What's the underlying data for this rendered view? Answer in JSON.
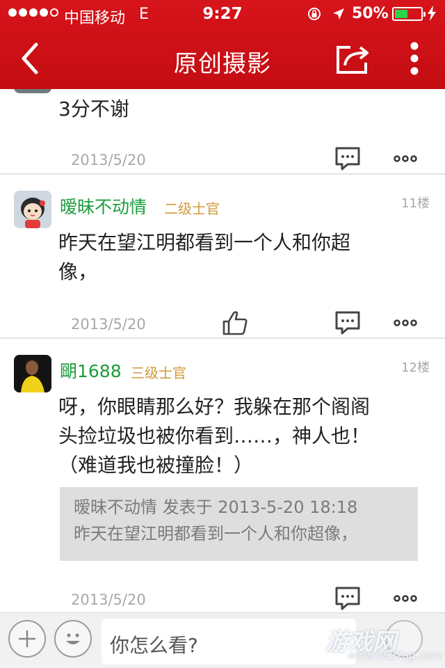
{
  "status_bar": {
    "carrier": "中国移动",
    "network": "E",
    "time": "9:27",
    "battery_text": "50%",
    "battery_level": 0.5,
    "signal_bars": 4,
    "signal_max": 5
  },
  "nav": {
    "title": "原创摄影"
  },
  "top_post": {
    "text": "3分不谢",
    "date": "2013/5/20"
  },
  "posts": [
    {
      "username": "暧昧不动情",
      "rank": "二级士官",
      "floor": "11楼",
      "text_lines": [
        "昨天在望江明都看到一个人和你超",
        "像，"
      ],
      "date": "2013/5/20"
    },
    {
      "username": "朙1688",
      "rank": "三级士官",
      "floor": "12楼",
      "text_lines": [
        "呀，你眼睛那么好？我躲在那个阁阁",
        "头捡垃圾也被你看到……，神人也！",
        "（难道我也被撞脸！）"
      ],
      "quote_lines": [
        "暧昧不动情 发表于 2013-5-20 18:18",
        "昨天在望江明都看到一个人和你超像，"
      ],
      "date": "2013/5/20"
    }
  ],
  "composer": {
    "placeholder": "你怎么看?"
  },
  "watermark": {
    "text": "游戏网",
    "url": "www.0827ug.com"
  },
  "colors": {
    "header": "#d0121a",
    "username": "#1d9c3d",
    "rank": "#d19a3a",
    "battery_fill": "#2bd34a"
  }
}
